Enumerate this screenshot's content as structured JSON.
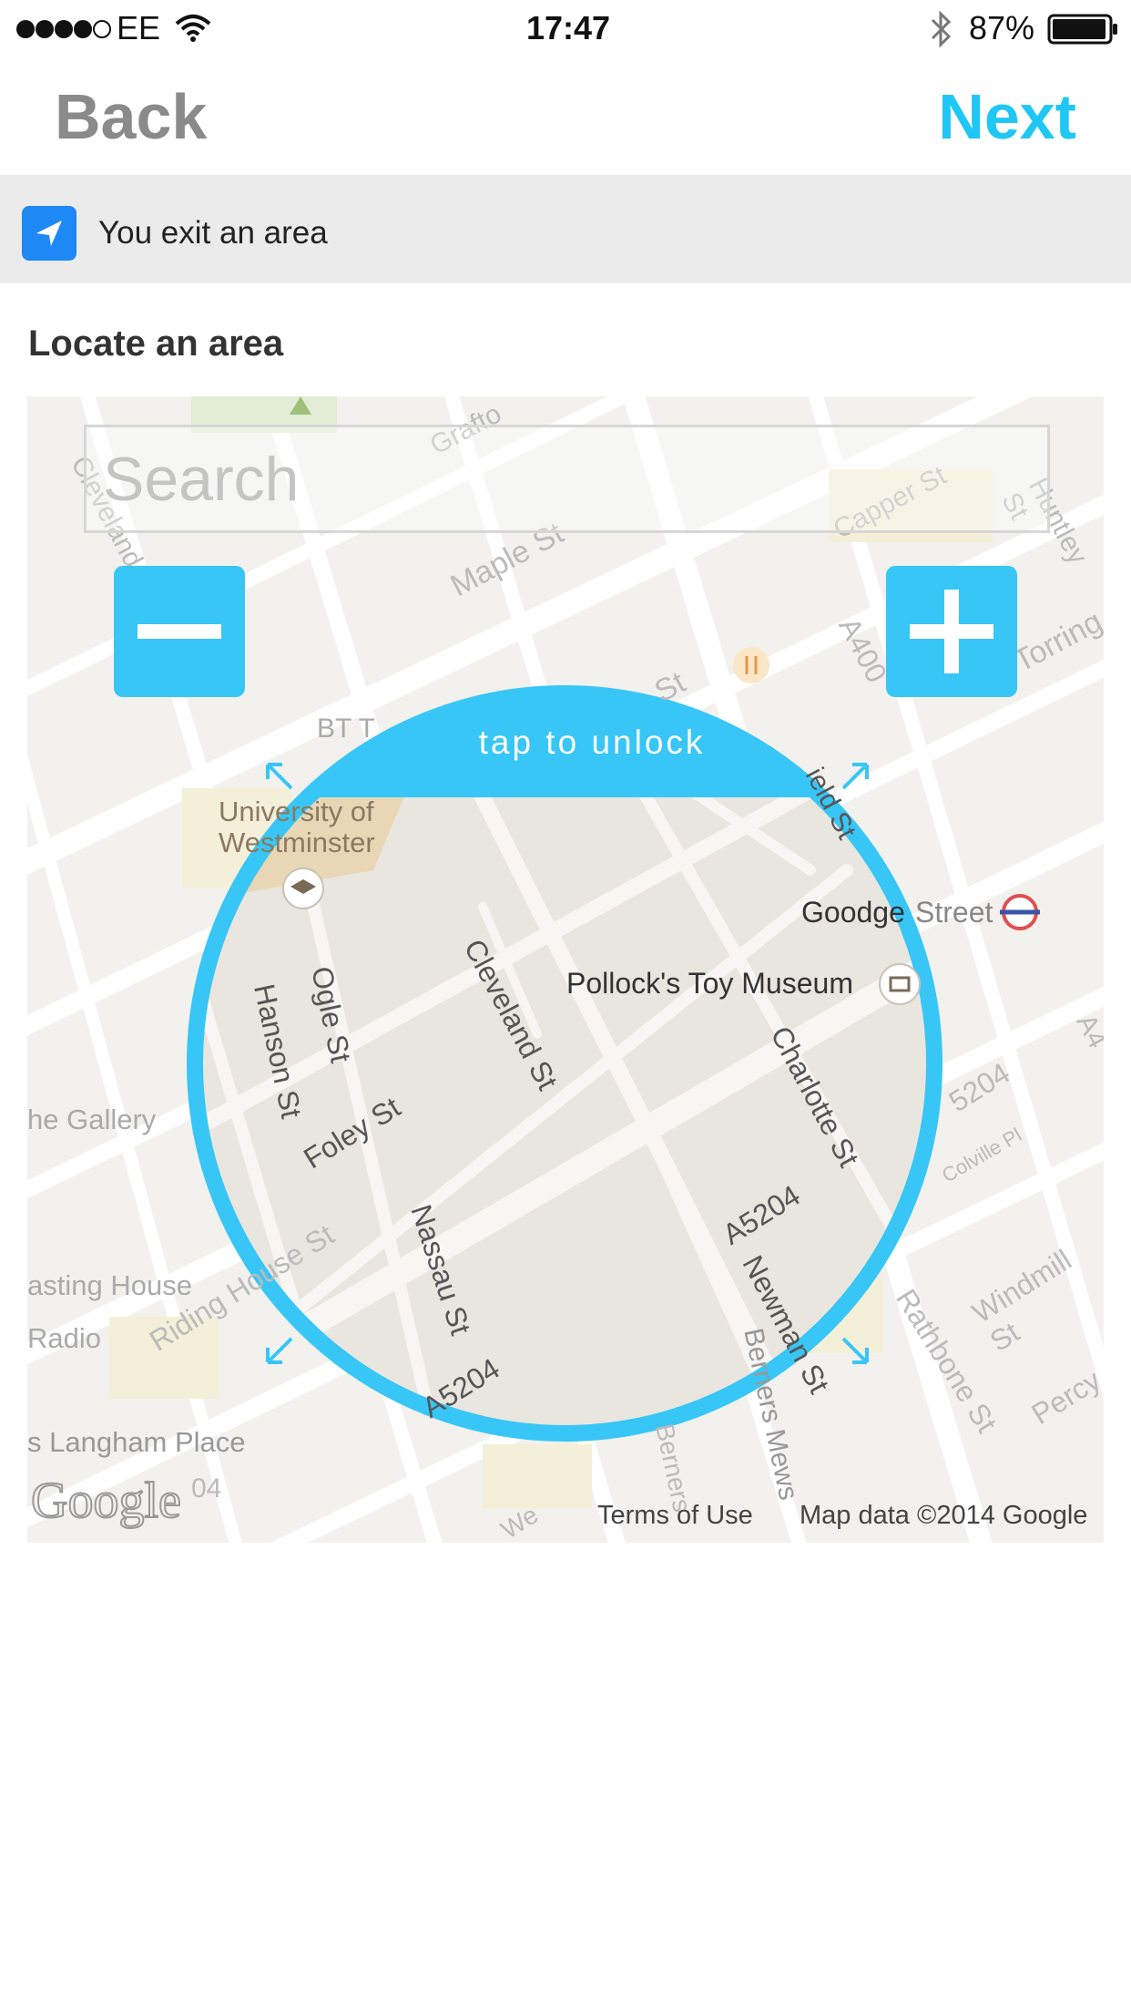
{
  "status_bar": {
    "carrier": "EE",
    "time": "17:47",
    "battery": "87%"
  },
  "nav": {
    "back_label": "Back",
    "next_label": "Next"
  },
  "trigger": {
    "label": "You exit an area",
    "icon": "location-arrow-icon"
  },
  "section": {
    "title": "Locate an area"
  },
  "map": {
    "search_placeholder": "Search",
    "lock_banner": "tap to unlock",
    "zoom_out_icon": "minus-icon",
    "zoom_in_icon": "plus-icon",
    "terms_label": "Terms of Use",
    "map_data_label": "Map data ©2014 Google",
    "logo_text": "Google",
    "labels": {
      "grafton": "Grafto",
      "capper": "Capper St",
      "huntley": "Huntley St",
      "maple": "Maple St",
      "torring": "Torring",
      "a400": "A400",
      "st_partial": "St",
      "bt_tower": "BT T",
      "univ1": "University of",
      "univ2": "Westminster",
      "field_st": "ield St",
      "goodge": "Goodge",
      "goodge_street": "Street",
      "pollocks": "Pollock's Toy Museum",
      "cleveland": "Cleveland St",
      "ogle": "Ogle St",
      "hanson": "Hanson St",
      "foley": "Foley St",
      "charlotte": "Charlotte St",
      "gallery": "he Gallery",
      "a5204": "A5204",
      "a5204_b": "A5204",
      "a5204_c": "5204",
      "a5204_d": "A5204",
      "colville": "Colville Pl",
      "a4": "A4",
      "casting": "asting House",
      "radio": "Radio",
      "riding": "Riding House St",
      "nassau": "Nassau St",
      "newman": "Newman St",
      "berners": "Berners Mews",
      "berners_st": "Berners",
      "rathbone": "Rathbone St",
      "windmill": "Windmill St",
      "percy": "Percy",
      "langham": "s Langham Place",
      "a4_204": "04",
      "we": "We",
      "cleveland_top": "Cleveland"
    }
  },
  "colors": {
    "accent": "#37c6f6",
    "next": "#1fc7f5",
    "back": "#8a8a8a",
    "trigger_icon": "#1e88f5"
  }
}
